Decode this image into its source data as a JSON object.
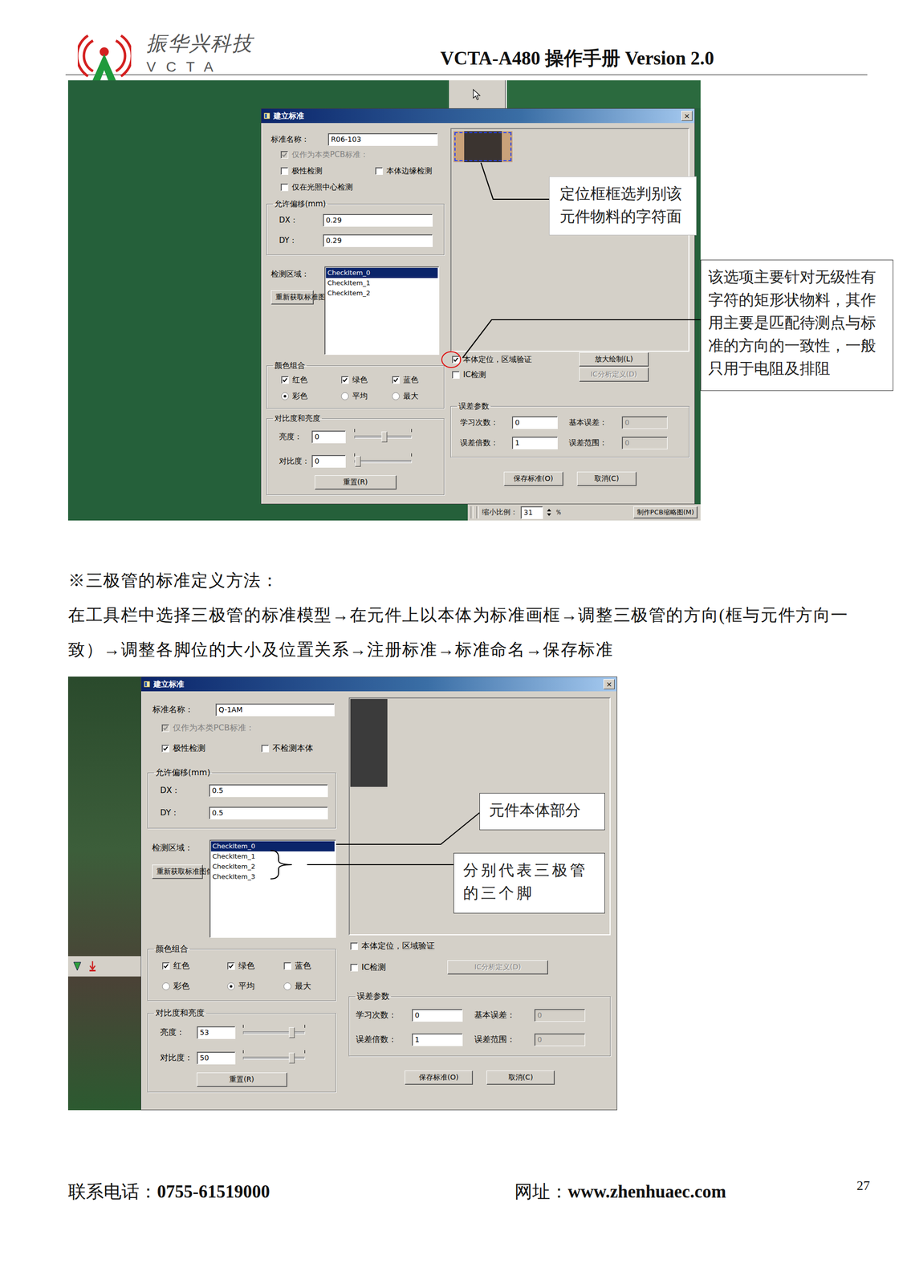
{
  "header": {
    "company": "振华兴科技",
    "company_sub": "V C T A",
    "title": "VCTA-A480 操作手册 Version 2.0"
  },
  "figures": [
    {
      "dialog": {
        "title": "建立标准",
        "close": "×",
        "name_label": "标准名称：",
        "name_value": "R06-103",
        "options": [
          [
            {
              "label": "仅作为本类PCB标准：",
              "checked": true,
              "disabled": true
            }
          ],
          [
            {
              "label": "极性检测",
              "checked": false,
              "disabled": false
            },
            {
              "label": "本体边缘检测",
              "checked": false,
              "disabled": false
            }
          ],
          [
            {
              "label": "仅在光照中心检测",
              "checked": false,
              "disabled": false
            }
          ]
        ],
        "offset": {
          "legend": "允许偏移(mm)",
          "fields": [
            {
              "label": "DX：",
              "value": "0.29"
            },
            {
              "label": "DY：",
              "value": "0.29"
            }
          ]
        },
        "area": {
          "label": "检测区域：",
          "button": "重新获取标准图像",
          "items": [
            {
              "label": "CheckItem_0",
              "selected": true
            },
            {
              "label": "CheckItem_1",
              "selected": false
            },
            {
              "label": "CheckItem_2",
              "selected": false
            }
          ]
        },
        "colors": {
          "legend": "颜色组合",
          "channels": [
            {
              "label": "红色",
              "checked": true
            },
            {
              "label": "绿色",
              "checked": true
            },
            {
              "label": "蓝色",
              "checked": true
            }
          ],
          "modes": [
            {
              "label": "彩色",
              "selected": true
            },
            {
              "label": "平均",
              "selected": false
            },
            {
              "label": "最大",
              "selected": false
            }
          ]
        },
        "contrast": {
          "legend": "对比度和亮度",
          "sliders": [
            {
              "label": "亮度：",
              "value": "0",
              "level": 0.52
            },
            {
              "label": "对比度：",
              "value": "0",
              "level": 0.06
            }
          ],
          "reset": "重置(R)"
        },
        "checks": [
          {
            "label": "本体定位，区域验证",
            "checked": true,
            "highlighted": true,
            "button": {
              "label": "放大绘制(L)",
              "disabled": false
            }
          },
          {
            "label": "IC检测",
            "checked": false,
            "highlighted": false,
            "button": {
              "label": "IC分析定义(D)",
              "disabled": true
            }
          }
        ],
        "errors": {
          "legend": "误差参数",
          "fields": [
            {
              "label": "学习次数：",
              "value": "0",
              "disabled": false
            },
            {
              "label": "基本误差：",
              "value": "0",
              "disabled": true
            },
            {
              "label": "误差倍数：",
              "value": "1",
              "disabled": false
            },
            {
              "label": "误差范围：",
              "value": "0",
              "disabled": true
            }
          ]
        },
        "buttons": [
          "保存标准(O)",
          "取消(C)"
        ]
      },
      "statusbar": {
        "label": "缩小比例：",
        "value": "31",
        "unit": "％",
        "button": "制作PCB缩略图(M)"
      },
      "callouts": [
        {
          "text": "定位框框选判别该元件物料的字符面"
        },
        {
          "text": "该选项主要针对无级性有字符的矩形状物料，其作用主要是匹配待测点与标准的方向的一致性，一般只用于电阻及排阻"
        }
      ]
    },
    {
      "dialog": {
        "title": "建立标准",
        "close": "×",
        "name_label": "标准名称：",
        "name_value": "Q-1AM",
        "options": [
          [
            {
              "label": "仅作为本类PCB标准：",
              "checked": true,
              "disabled": true
            }
          ],
          [
            {
              "label": "极性检测",
              "checked": true,
              "disabled": false
            },
            {
              "label": "不检测本体",
              "checked": false,
              "disabled": false
            }
          ]
        ],
        "offset": {
          "legend": "允许偏移(mm)",
          "fields": [
            {
              "label": "DX：",
              "value": "0.5"
            },
            {
              "label": "DY：",
              "value": "0.5"
            }
          ]
        },
        "area": {
          "label": "检测区域：",
          "button": "重新获取标准图像",
          "items": [
            {
              "label": "CheckItem_0",
              "selected": true
            },
            {
              "label": "CheckItem_1",
              "selected": false
            },
            {
              "label": "CheckItem_2",
              "selected": false
            },
            {
              "label": "CheckItem_3",
              "selected": false
            }
          ]
        },
        "colors": {
          "legend": "颜色组合",
          "channels": [
            {
              "label": "红色",
              "checked": true
            },
            {
              "label": "绿色",
              "checked": true
            },
            {
              "label": "蓝色",
              "checked": false
            }
          ],
          "modes": [
            {
              "label": "彩色",
              "selected": false
            },
            {
              "label": "平均",
              "selected": true
            },
            {
              "label": "最大",
              "selected": false
            }
          ]
        },
        "contrast": {
          "legend": "对比度和亮度",
          "sliders": [
            {
              "label": "亮度：",
              "value": "53",
              "level": 0.79
            },
            {
              "label": "对比度：",
              "value": "50",
              "level": 0.79
            }
          ],
          "reset": "重置(R)"
        },
        "checks": [
          {
            "label": "本体定位，区域验证",
            "checked": false,
            "highlighted": false
          },
          {
            "label": "IC检测",
            "checked": false,
            "highlighted": false,
            "button": {
              "label": "IC分析定义(D)",
              "disabled": true
            }
          }
        ],
        "errors": {
          "legend": "误差参数",
          "fields": [
            {
              "label": "学习次数：",
              "value": "0",
              "disabled": false
            },
            {
              "label": "基本误差：",
              "value": "0",
              "disabled": true
            },
            {
              "label": "误差倍数：",
              "value": "1",
              "disabled": false
            },
            {
              "label": "误差范围：",
              "value": "0",
              "disabled": true
            }
          ]
        },
        "buttons": [
          "保存标准(O)",
          "取消(C)"
        ]
      },
      "callouts": [
        {
          "text": "元件本体部分"
        },
        {
          "text": "分别代表三极管的三个脚"
        }
      ]
    }
  ],
  "section": {
    "heading": "※三极管的标准定义方法：",
    "body": "在工具栏中选择三极管的标准模型→在元件上以本体为标准画框→调整三极管的方向(框与元件方向一致）→调整各脚位的大小及位置关系→注册标准→标准命名→保存标准"
  },
  "footer": {
    "phone_label": "联系电话：",
    "phone": "0755-61519000",
    "web_label": "网址：",
    "web": "www.zhenhuaec.com",
    "page": "27"
  }
}
